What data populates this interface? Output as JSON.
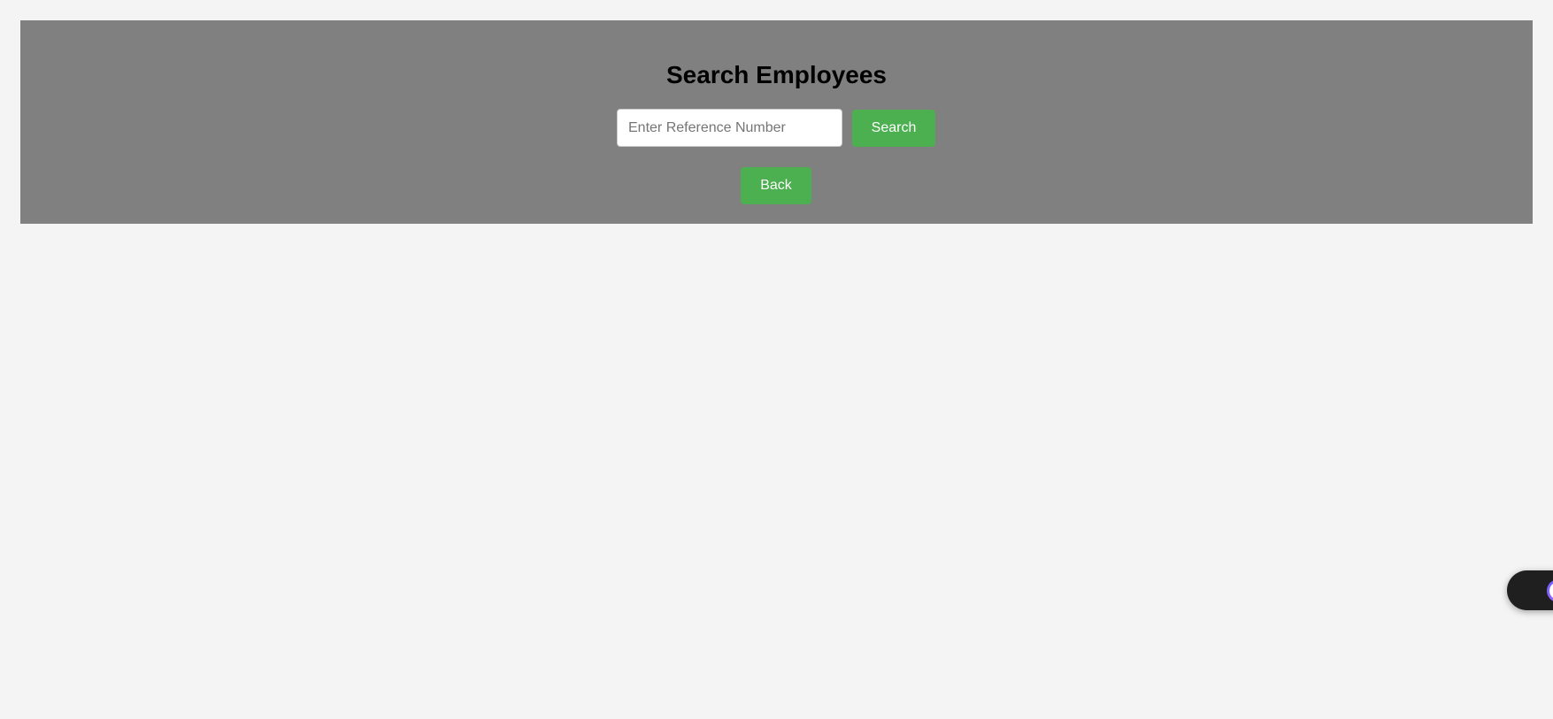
{
  "header": {
    "title": "Search Employees"
  },
  "search": {
    "placeholder": "Enter Reference Number",
    "value": "",
    "button_label": "Search"
  },
  "navigation": {
    "back_label": "Back"
  },
  "assistant": {
    "icon": "assistant-face-icon"
  },
  "colors": {
    "page_background": "#f4f4f4",
    "panel_background": "#808080",
    "button_background": "#4caf50",
    "button_text": "#ffffff"
  }
}
